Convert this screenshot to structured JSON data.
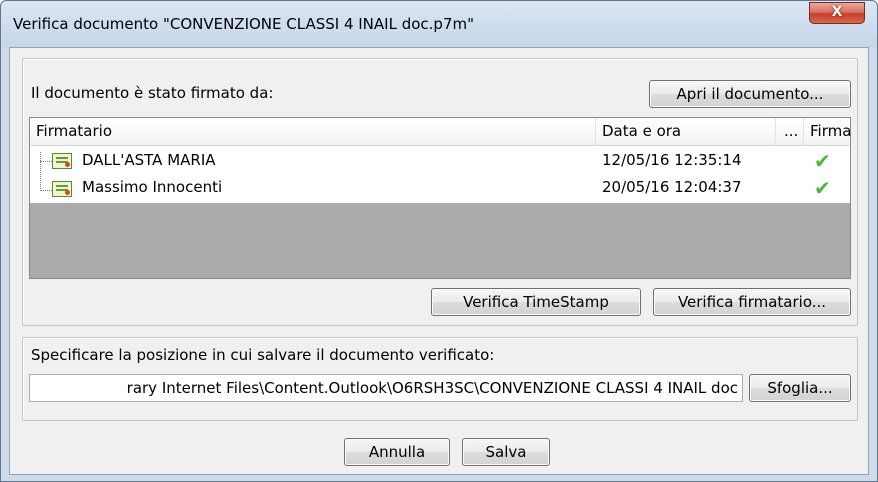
{
  "window": {
    "title": "Verifica documento \"CONVENZIONE CLASSI 4 INAIL doc.p7m\"",
    "close_label": "X"
  },
  "signers_group": {
    "label": "Il documento è stato firmato da:",
    "open_button": "Apri il documento...",
    "columns": {
      "signer": "Firmatario",
      "date": "Data e ora",
      "more": "...",
      "signature": "Firma"
    },
    "rows": [
      {
        "name": "DALL'ASTA MARIA",
        "date": "12/05/16 12:35:14",
        "signature_icon": "check-icon",
        "signature_ok": true
      },
      {
        "name": "Massimo Innocenti",
        "date": "20/05/16 12:04:37",
        "signature_icon": "check-icon",
        "signature_ok": true
      }
    ],
    "verify_timestamp_button": "Verifica TimeStamp",
    "verify_signer_button": "Verifica firmatario..."
  },
  "save_group": {
    "label": "Specificare la posizione in cui salvare il documento verificato:",
    "path_value": "rary Internet Files\\Content.Outlook\\O6RSH3SC\\CONVENZIONE CLASSI 4 INAIL doc",
    "browse_button": "Sfoglia..."
  },
  "footer": {
    "cancel_button": "Annulla",
    "save_button": "Salva"
  },
  "colors": {
    "check": "#4cb830",
    "grid_empty": "#ababab",
    "close_button": "#c6402a"
  }
}
